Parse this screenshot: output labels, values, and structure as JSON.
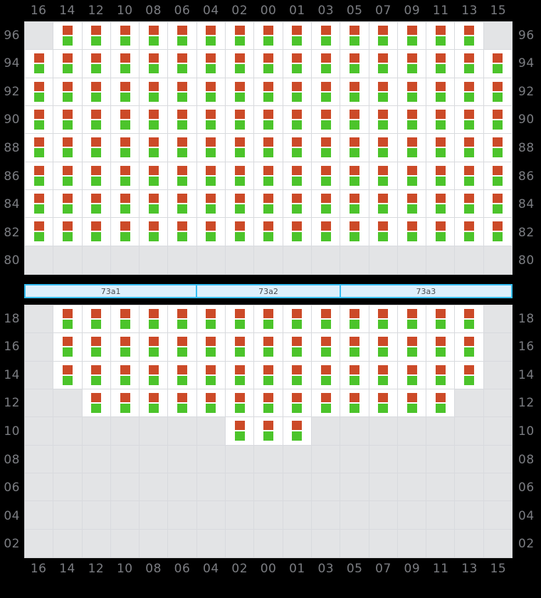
{
  "meta": {
    "colors": {
      "seat_top": "#cc4a28",
      "seat_bottom": "#4cc42b",
      "cell_empty": "#e3e4e6",
      "cell_filled": "#ffffff",
      "grid_line": "#d8dade",
      "zone_border": "#35bdf4",
      "zone_fill": "#ddeffc",
      "label_text": "#7b7d82",
      "background": "#000000"
    },
    "icon_name": "seat-indicator-icon"
  },
  "columns": [
    "16",
    "14",
    "12",
    "10",
    "08",
    "06",
    "04",
    "02",
    "00",
    "01",
    "03",
    "05",
    "07",
    "09",
    "11",
    "13",
    "15"
  ],
  "upper_section": {
    "row_labels": [
      "96",
      "94",
      "92",
      "90",
      "88",
      "86",
      "84",
      "82",
      "80"
    ],
    "rows": [
      {
        "label": "96",
        "cells": [
          0,
          1,
          1,
          1,
          1,
          1,
          1,
          1,
          1,
          1,
          1,
          1,
          1,
          1,
          1,
          1,
          0
        ]
      },
      {
        "label": "94",
        "cells": [
          1,
          1,
          1,
          1,
          1,
          1,
          1,
          1,
          1,
          1,
          1,
          1,
          1,
          1,
          1,
          1,
          1
        ]
      },
      {
        "label": "92",
        "cells": [
          1,
          1,
          1,
          1,
          1,
          1,
          1,
          1,
          1,
          1,
          1,
          1,
          1,
          1,
          1,
          1,
          1
        ]
      },
      {
        "label": "90",
        "cells": [
          1,
          1,
          1,
          1,
          1,
          1,
          1,
          1,
          1,
          1,
          1,
          1,
          1,
          1,
          1,
          1,
          1
        ]
      },
      {
        "label": "88",
        "cells": [
          1,
          1,
          1,
          1,
          1,
          1,
          1,
          1,
          1,
          1,
          1,
          1,
          1,
          1,
          1,
          1,
          1
        ]
      },
      {
        "label": "86",
        "cells": [
          1,
          1,
          1,
          1,
          1,
          1,
          1,
          1,
          1,
          1,
          1,
          1,
          1,
          1,
          1,
          1,
          1
        ]
      },
      {
        "label": "84",
        "cells": [
          1,
          1,
          1,
          1,
          1,
          1,
          1,
          1,
          1,
          1,
          1,
          1,
          1,
          1,
          1,
          1,
          1
        ]
      },
      {
        "label": "82",
        "cells": [
          1,
          1,
          1,
          1,
          1,
          1,
          1,
          1,
          1,
          1,
          1,
          1,
          1,
          1,
          1,
          1,
          1
        ]
      },
      {
        "label": "80",
        "cells": [
          0,
          0,
          0,
          0,
          0,
          0,
          0,
          0,
          0,
          0,
          0,
          0,
          0,
          0,
          0,
          0,
          0
        ]
      }
    ]
  },
  "zone_bar": {
    "zones": [
      {
        "label": "73a1",
        "span": 6
      },
      {
        "label": "73a2",
        "span": 5
      },
      {
        "label": "73a3",
        "span": 6
      }
    ]
  },
  "lower_section": {
    "row_labels": [
      "18",
      "16",
      "14",
      "12",
      "10",
      "08",
      "06",
      "04",
      "02"
    ],
    "rows": [
      {
        "label": "18",
        "cells": [
          0,
          1,
          1,
          1,
          1,
          1,
          1,
          1,
          1,
          1,
          1,
          1,
          1,
          1,
          1,
          1,
          0
        ]
      },
      {
        "label": "16",
        "cells": [
          0,
          1,
          1,
          1,
          1,
          1,
          1,
          1,
          1,
          1,
          1,
          1,
          1,
          1,
          1,
          1,
          0
        ]
      },
      {
        "label": "14",
        "cells": [
          0,
          1,
          1,
          1,
          1,
          1,
          1,
          1,
          1,
          1,
          1,
          1,
          1,
          1,
          1,
          1,
          0
        ]
      },
      {
        "label": "12",
        "cells": [
          0,
          0,
          1,
          1,
          1,
          1,
          1,
          1,
          1,
          1,
          1,
          1,
          1,
          1,
          1,
          0,
          0
        ]
      },
      {
        "label": "10",
        "cells": [
          0,
          0,
          0,
          0,
          0,
          0,
          0,
          1,
          1,
          1,
          0,
          0,
          0,
          0,
          0,
          0,
          0
        ]
      },
      {
        "label": "08",
        "cells": [
          0,
          0,
          0,
          0,
          0,
          0,
          0,
          0,
          0,
          0,
          0,
          0,
          0,
          0,
          0,
          0,
          0
        ]
      },
      {
        "label": "06",
        "cells": [
          0,
          0,
          0,
          0,
          0,
          0,
          0,
          0,
          0,
          0,
          0,
          0,
          0,
          0,
          0,
          0,
          0
        ]
      },
      {
        "label": "04",
        "cells": [
          0,
          0,
          0,
          0,
          0,
          0,
          0,
          0,
          0,
          0,
          0,
          0,
          0,
          0,
          0,
          0,
          0
        ]
      },
      {
        "label": "02",
        "cells": [
          0,
          0,
          0,
          0,
          0,
          0,
          0,
          0,
          0,
          0,
          0,
          0,
          0,
          0,
          0,
          0,
          0
        ]
      }
    ]
  }
}
